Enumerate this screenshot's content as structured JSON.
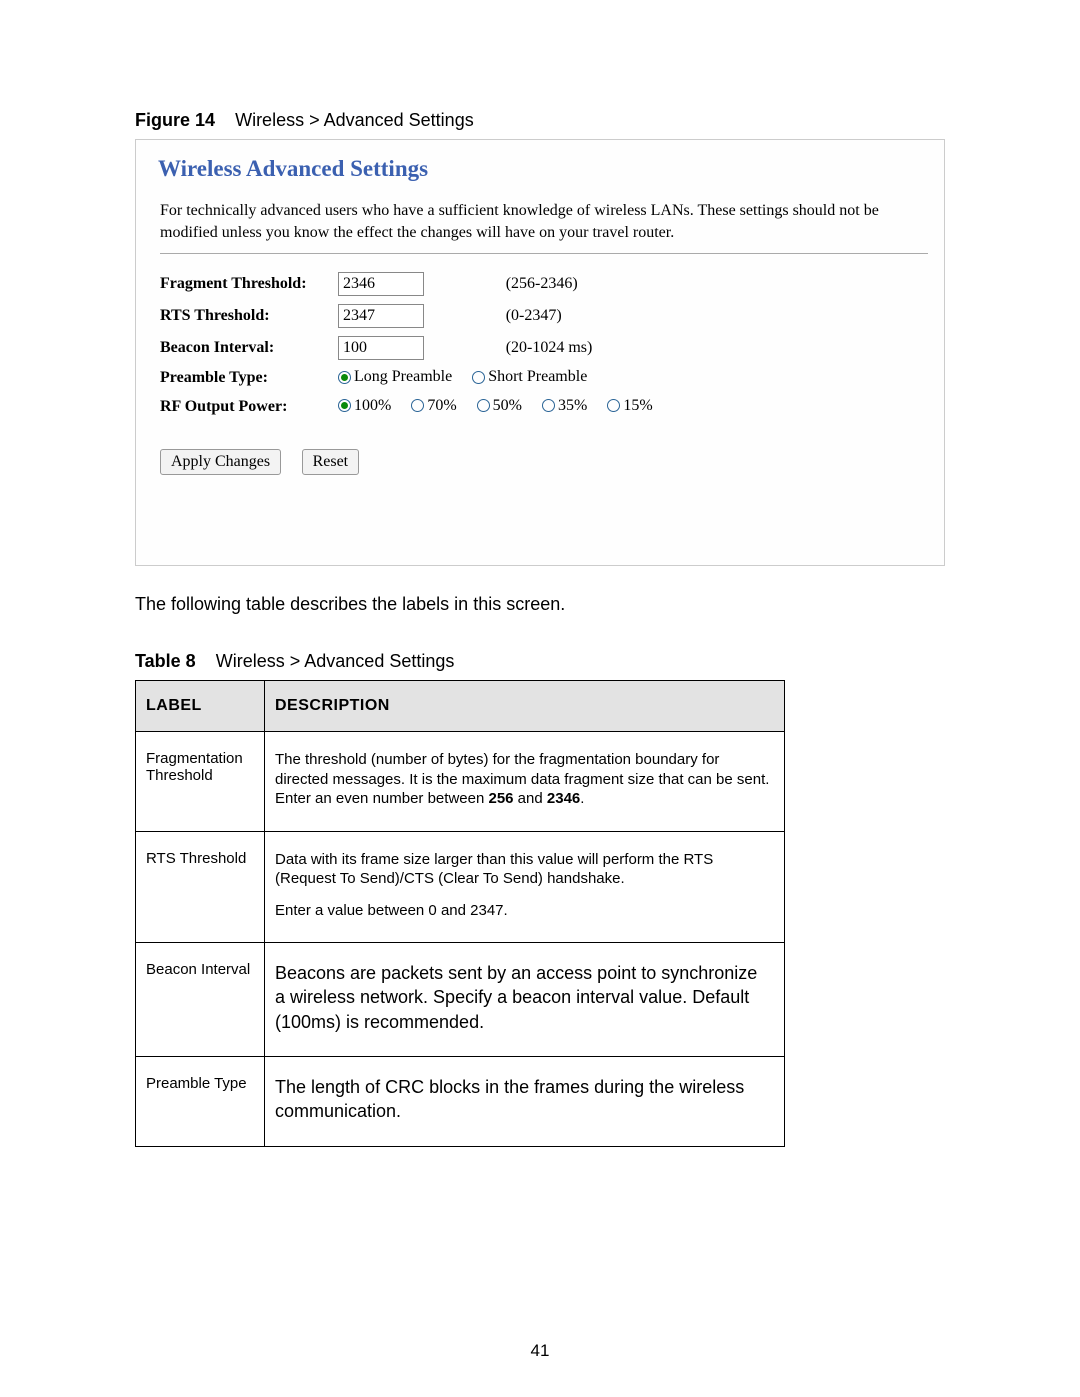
{
  "figure": {
    "label": "Figure 14",
    "title": "Wireless > Advanced Settings"
  },
  "panel": {
    "title": "Wireless Advanced Settings",
    "desc": "For technically advanced users who have a sufficient knowledge of wireless LANs. These settings should not be modified unless you know the effect the changes will have on your travel router.",
    "fields": {
      "frag": {
        "label": "Fragment Threshold:",
        "value": "2346",
        "range": "(256-2346)"
      },
      "rts": {
        "label": "RTS Threshold:",
        "value": "2347",
        "range": "(0-2347)"
      },
      "beacon": {
        "label": "Beacon Interval:",
        "value": "100",
        "range": "(20-1024 ms)"
      },
      "preamble": {
        "label": "Preamble Type:",
        "long": "Long Preamble",
        "short": "Short Preamble"
      },
      "rf": {
        "label": "RF Output Power:",
        "p100": "100%",
        "p70": "70%",
        "p50": "50%",
        "p35": "35%",
        "p15": "15%"
      }
    },
    "apply": "Apply Changes",
    "reset": "Reset"
  },
  "intro": "The following table describes the labels in this screen.",
  "table": {
    "label": "Table 8",
    "title": "Wireless > Advanced Settings",
    "h1": "LABEL",
    "h2": "DESCRIPTION",
    "rows": {
      "r1": {
        "label": "Fragmentation Threshold",
        "desc_pre": "The threshold (number of bytes) for the fragmentation boundary for directed messages. It is the maximum data fragment size that can be sent. Enter an even number between ",
        "b1": "256",
        "mid": " and ",
        "b2": "2346",
        "suffix": "."
      },
      "r2": {
        "label": "RTS Threshold",
        "p1": "Data with its frame size larger than this value will perform the RTS (Request To Send)/CTS (Clear To Send) handshake.",
        "p2": "Enter a value between 0 and 2347."
      },
      "r3": {
        "label": "Beacon Interval",
        "desc": "Beacons are packets sent by an access point to synchronize a wireless network. Specify a beacon interval value. Default (100ms) is recommended."
      },
      "r4": {
        "label": "Preamble Type",
        "desc": "The length of CRC blocks in the frames during the wireless communication."
      }
    }
  },
  "pageNumber": "41"
}
